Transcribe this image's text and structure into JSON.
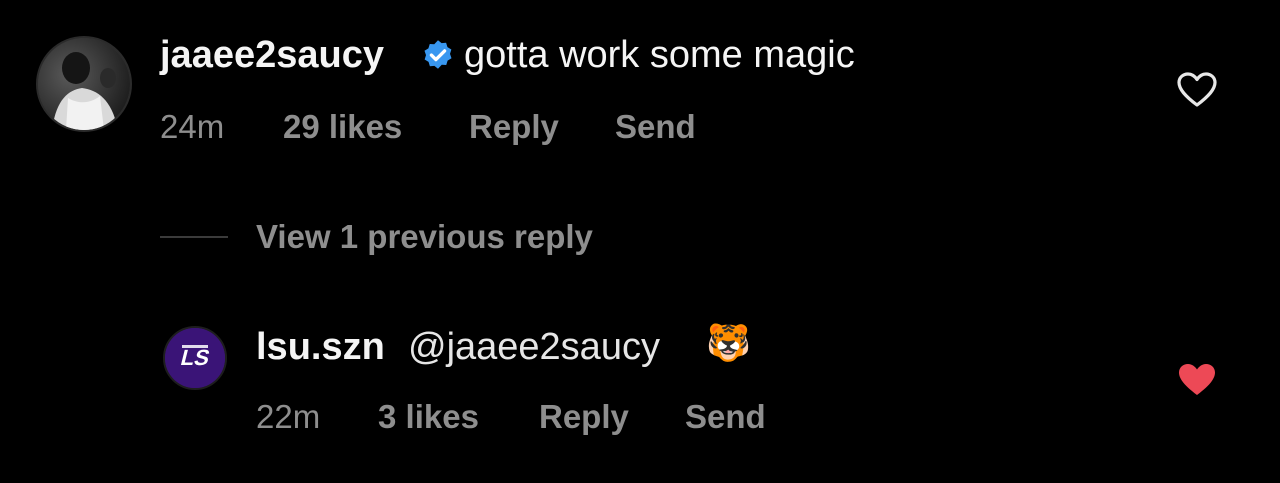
{
  "comments": [
    {
      "username": "jaaee2saucy",
      "verified": true,
      "text": "gotta work some magic",
      "time": "24m",
      "likes": "29 likes",
      "reply_label": "Reply",
      "send_label": "Send",
      "liked": false
    }
  ],
  "replies_toggle": {
    "label": "View 1 previous reply"
  },
  "replies": [
    {
      "username": "lsu.szn",
      "mention": "@jaaee2saucy",
      "emoji": "🐯",
      "time": "22m",
      "likes": "3 likes",
      "reply_label": "Reply",
      "send_label": "Send",
      "liked": true,
      "avatar_logo_text": "LS"
    }
  ],
  "colors": {
    "background": "#000000",
    "primary_text": "#f5f5f5",
    "secondary_text": "#8e8e8e",
    "verified_blue": "#3897f0",
    "liked_red": "#ed4956",
    "lsu_purple": "#3a1477"
  },
  "icons": {
    "verified": "verified-badge-icon",
    "heart_outline": "heart-outline-icon",
    "heart_filled": "heart-filled-icon"
  }
}
